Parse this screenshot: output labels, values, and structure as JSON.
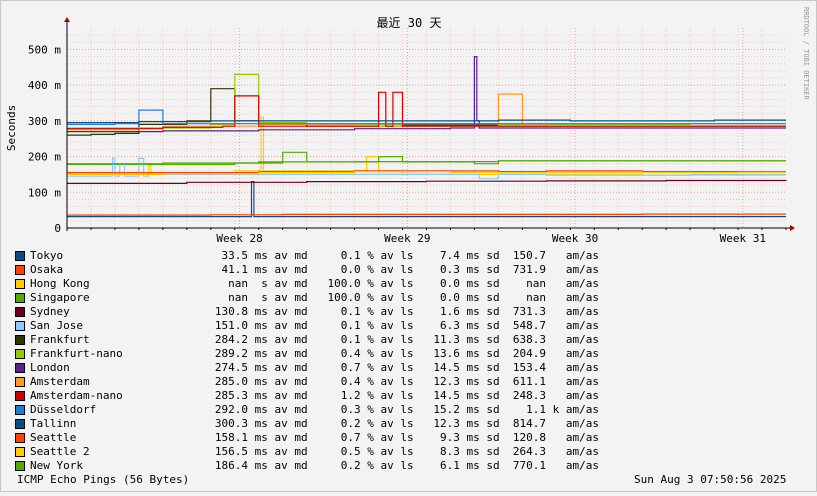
{
  "chart_data": {
    "type": "line",
    "title": "最近 30 天",
    "ylabel": "Seconds",
    "ylim": [
      0,
      560
    ],
    "y_unit": "m",
    "grid": true,
    "legend_placement": "bottom",
    "x_ticks": [
      "Week 28",
      "Week 29",
      "Week 30",
      "Week 31"
    ],
    "y_ticks": [
      {
        "value": 0,
        "label": "0"
      },
      {
        "value": 100,
        "label": "100 m"
      },
      {
        "value": 200,
        "label": "200 m"
      },
      {
        "value": 300,
        "label": "300 m"
      },
      {
        "value": 400,
        "label": "400 m"
      },
      {
        "value": 500,
        "label": "500 m"
      }
    ],
    "x_range": [
      0,
      30
    ],
    "series": [
      {
        "name": "Tokyo",
        "color": "#0b4f8a",
        "stats": "33.5 ms av md     0.1 % av ls    7.4 ms sd  150.7   am/as",
        "x": [
          0,
          5.9,
          6.0,
          7.6,
          7.7,
          7.8,
          8.0,
          30
        ],
        "y": [
          32,
          32,
          32,
          32,
          130,
          32,
          32,
          32
        ]
      },
      {
        "name": "Osaka",
        "color": "#ff4400",
        "stats": "41.1 ms av md     0.0 % av ls    0.3 ms sd  731.9   am/as",
        "x": [
          0,
          3,
          6,
          9,
          12,
          15,
          18,
          21,
          24,
          27,
          30
        ],
        "y": [
          36,
          36,
          37,
          38,
          38,
          38,
          38,
          38,
          39,
          39,
          39
        ]
      },
      {
        "name": "Hong Kong",
        "color": "#ffcc00",
        "stats": "nan  s av md   100.0 % av ls    0.0 ms sd    nan   am/as",
        "x": [
          0,
          2,
          3.3,
          3.4,
          3.5,
          4,
          6,
          7,
          8,
          8.1,
          8.2,
          10,
          12,
          12.5,
          13,
          13.5,
          14,
          16,
          18,
          20,
          22,
          24,
          26,
          28,
          30
        ],
        "y": [
          150,
          150,
          150,
          175,
          150,
          150,
          155,
          160,
          160,
          310,
          160,
          160,
          160,
          200,
          160,
          160,
          150,
          150,
          150,
          150,
          150,
          148,
          148,
          148,
          148
        ]
      },
      {
        "name": "Singapore",
        "color": "#55aa00",
        "stats": "nan  s av md   100.0 % av ls    0.0 ms sd    nan   am/as",
        "x": [
          0,
          5,
          6,
          7,
          8,
          9,
          10,
          11,
          12,
          13,
          14,
          15,
          16,
          17,
          18,
          20,
          22,
          24,
          26,
          28,
          30
        ],
        "y": [
          178,
          178,
          178,
          182,
          182,
          212,
          185,
          185,
          185,
          200,
          185,
          185,
          185,
          180,
          188,
          188,
          188,
          188,
          188,
          188,
          188
        ]
      },
      {
        "name": "Sydney",
        "color": "#6b0021",
        "stats": "130.8 ms av md     0.1 % av ls    1.6 ms sd  731.3   am/as",
        "x": [
          0,
          5,
          10,
          15,
          20,
          25,
          30
        ],
        "y": [
          125,
          128,
          130,
          131,
          132,
          133,
          134
        ]
      },
      {
        "name": "San Jose",
        "color": "#88ccff",
        "stats": "151.0 ms av md     0.1 % av ls    6.3 ms sd  548.7   am/as",
        "x": [
          0,
          1.8,
          1.9,
          2.0,
          2.2,
          2.4,
          3.0,
          3.2,
          3.4,
          5,
          6,
          7,
          8,
          10,
          12,
          14,
          16,
          17,
          17.2,
          18,
          20,
          22,
          24,
          26,
          28,
          30
        ],
        "y": [
          145,
          145,
          195,
          145,
          180,
          145,
          195,
          145,
          150,
          150,
          150,
          150,
          150,
          150,
          150,
          150,
          150,
          150,
          138,
          150,
          148,
          148,
          148,
          150,
          150,
          150
        ]
      },
      {
        "name": "Frankfurt",
        "color": "#333300",
        "stats": "284.2 ms av md     0.1 % av ls   11.3 ms sd  638.3   am/as",
        "x": [
          0,
          1,
          2,
          3,
          4,
          5,
          6,
          7,
          8,
          10,
          12,
          14,
          16,
          18,
          20,
          22,
          24,
          26,
          28,
          30
        ],
        "y": [
          260,
          262,
          265,
          290,
          290,
          300,
          390,
          300,
          290,
          285,
          285,
          288,
          288,
          285,
          285,
          285,
          285,
          285,
          285,
          285
        ]
      },
      {
        "name": "Frankfurt-nano",
        "color": "#99cc00",
        "stats": "289.2 ms av md     0.4 % av ls   13.6 ms sd  204.9   am/as",
        "x": [
          0,
          3,
          6,
          7,
          8,
          9,
          10,
          12,
          14,
          16,
          18,
          20,
          22,
          24,
          26,
          28,
          30
        ],
        "y": [
          275,
          280,
          290,
          430,
          295,
          295,
          290,
          290,
          292,
          292,
          290,
          290,
          290,
          290,
          292,
          292,
          292
        ]
      },
      {
        "name": "London",
        "color": "#552288",
        "stats": "274.5 ms av md     0.7 % av ls   14.5 ms sd  153.4   am/as",
        "x": [
          0,
          4,
          8,
          12,
          16,
          17,
          17.1,
          17.2,
          18,
          20,
          22,
          24,
          26,
          28,
          30
        ],
        "y": [
          270,
          272,
          275,
          278,
          280,
          480,
          300,
          280,
          280,
          280,
          280,
          280,
          280,
          280,
          280
        ]
      },
      {
        "name": "Amsterdam",
        "color": "#ff9922",
        "stats": "285.0 ms av md     0.4 % av ls   12.3 ms sd  611.1   am/as",
        "x": [
          0,
          4,
          8,
          12,
          16,
          17,
          18,
          19,
          20,
          22,
          24,
          26,
          28,
          30
        ],
        "y": [
          280,
          285,
          290,
          285,
          285,
          285,
          375,
          290,
          285,
          285,
          285,
          285,
          285,
          285
        ]
      },
      {
        "name": "Amsterdam-nano",
        "color": "#cc0000",
        "stats": "285.3 ms av md     1.2 % av ls   14.5 ms sd  248.3   am/as",
        "x": [
          0,
          4,
          6.5,
          7,
          8,
          10,
          12,
          13,
          13.3,
          13.6,
          14,
          16,
          18,
          20,
          22,
          24,
          26,
          28,
          30
        ],
        "y": [
          278,
          282,
          285,
          370,
          285,
          285,
          285,
          380,
          285,
          380,
          285,
          285,
          285,
          285,
          285,
          285,
          285,
          285,
          285
        ]
      },
      {
        "name": "Düsseldorf",
        "color": "#1c7fd0",
        "stats": "292.0 ms av md     0.3 % av ls   15.2 ms sd    1.1 k am/as",
        "x": [
          0,
          2,
          3,
          4,
          6,
          8,
          10,
          12,
          14,
          16,
          18,
          20,
          22,
          24,
          26,
          28,
          30
        ],
        "y": [
          290,
          292,
          330,
          292,
          292,
          292,
          292,
          292,
          292,
          292,
          292,
          292,
          292,
          292,
          292,
          292,
          292
        ]
      },
      {
        "name": "Tallinn",
        "color": "#0b4f8a",
        "stats": "300.3 ms av md     0.2 % av ls   12.3 ms sd  814.7   am/as",
        "x": [
          0,
          3,
          6,
          9,
          12,
          15,
          18,
          21,
          24,
          27,
          30
        ],
        "y": [
          295,
          298,
          300,
          300,
          300,
          300,
          302,
          300,
          300,
          302,
          302
        ]
      },
      {
        "name": "Seattle",
        "color": "#ff4400",
        "stats": "158.1 ms av md     0.7 % av ls    9.3 ms sd  120.8   am/as",
        "x": [
          0,
          4,
          8,
          12,
          16,
          18,
          20,
          22,
          24,
          26,
          28,
          30
        ],
        "y": [
          155,
          155,
          158,
          160,
          160,
          158,
          160,
          160,
          158,
          158,
          158,
          158
        ]
      },
      {
        "name": "Seattle 2",
        "color": "#ffcc00",
        "stats": "156.5 ms av md     0.5 % av ls    8.3 ms sd  264.3   am/as",
        "x": [
          0,
          4,
          8,
          12,
          16,
          18,
          20,
          22,
          24,
          26,
          28,
          30
        ],
        "y": [
          150,
          152,
          155,
          158,
          156,
          155,
          156,
          156,
          155,
          155,
          156,
          156
        ]
      },
      {
        "name": "New York",
        "color": "#55aa00",
        "stats": "186.4 ms av md     0.2 % av ls    6.1 ms sd  770.1   am/as",
        "x": [
          0,
          4,
          8,
          12,
          16,
          18,
          20,
          22,
          24,
          26,
          28,
          30
        ],
        "y": [
          180,
          182,
          185,
          186,
          186,
          188,
          188,
          188,
          188,
          188,
          188,
          188
        ]
      }
    ]
  },
  "footer": {
    "left": "ICMP Echo Pings (56 Bytes)",
    "right": "Sun Aug  3 07:50:56 2025"
  },
  "credit": "RRDTOOL / TOBI OETIKER"
}
